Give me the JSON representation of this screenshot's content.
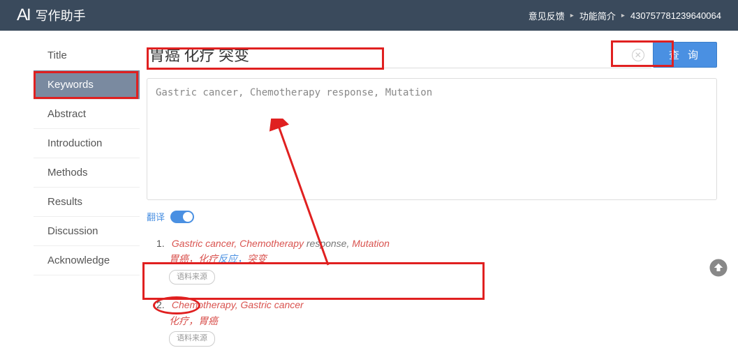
{
  "header": {
    "app_name": "写作助手",
    "logo_text": "AI",
    "links": {
      "feedback": "意见反馈",
      "features": "功能简介",
      "user_id": "430757781239640064"
    }
  },
  "sidebar": {
    "items": [
      {
        "label": "Title"
      },
      {
        "label": "Keywords"
      },
      {
        "label": "Abstract"
      },
      {
        "label": "Introduction"
      },
      {
        "label": "Methods"
      },
      {
        "label": "Results"
      },
      {
        "label": "Discussion"
      },
      {
        "label": "Acknowledge"
      }
    ],
    "active_index": 1
  },
  "search": {
    "value": "胃癌 化疗 突变",
    "query_label": "查 询"
  },
  "result_box": {
    "text": "Gastric cancer, Chemotherapy response, Mutation"
  },
  "translate": {
    "label": "翻译",
    "on": true
  },
  "results": [
    {
      "num": "1.",
      "en_parts": [
        {
          "t": "Gastric cancer",
          "hl": true
        },
        {
          "t": ", ",
          "hl": true
        },
        {
          "t": "Chemotherapy",
          "hl": true
        },
        {
          "t": " response, ",
          "hl": false
        },
        {
          "t": "Mutation",
          "hl": true
        }
      ],
      "zh_parts": [
        {
          "t": "胃癌，化疗",
          "c": "red"
        },
        {
          "t": "反应，",
          "c": "blue"
        },
        {
          "t": "突变",
          "c": "red"
        }
      ],
      "source_label": "语料来源"
    },
    {
      "num": "2.",
      "en_parts": [
        {
          "t": "Chemotherapy",
          "hl": true
        },
        {
          "t": ", ",
          "hl": true
        },
        {
          "t": "Gastric cancer",
          "hl": true
        }
      ],
      "zh_parts": [
        {
          "t": "化疗，胃癌",
          "c": "red"
        }
      ],
      "source_label": "语料来源"
    }
  ]
}
